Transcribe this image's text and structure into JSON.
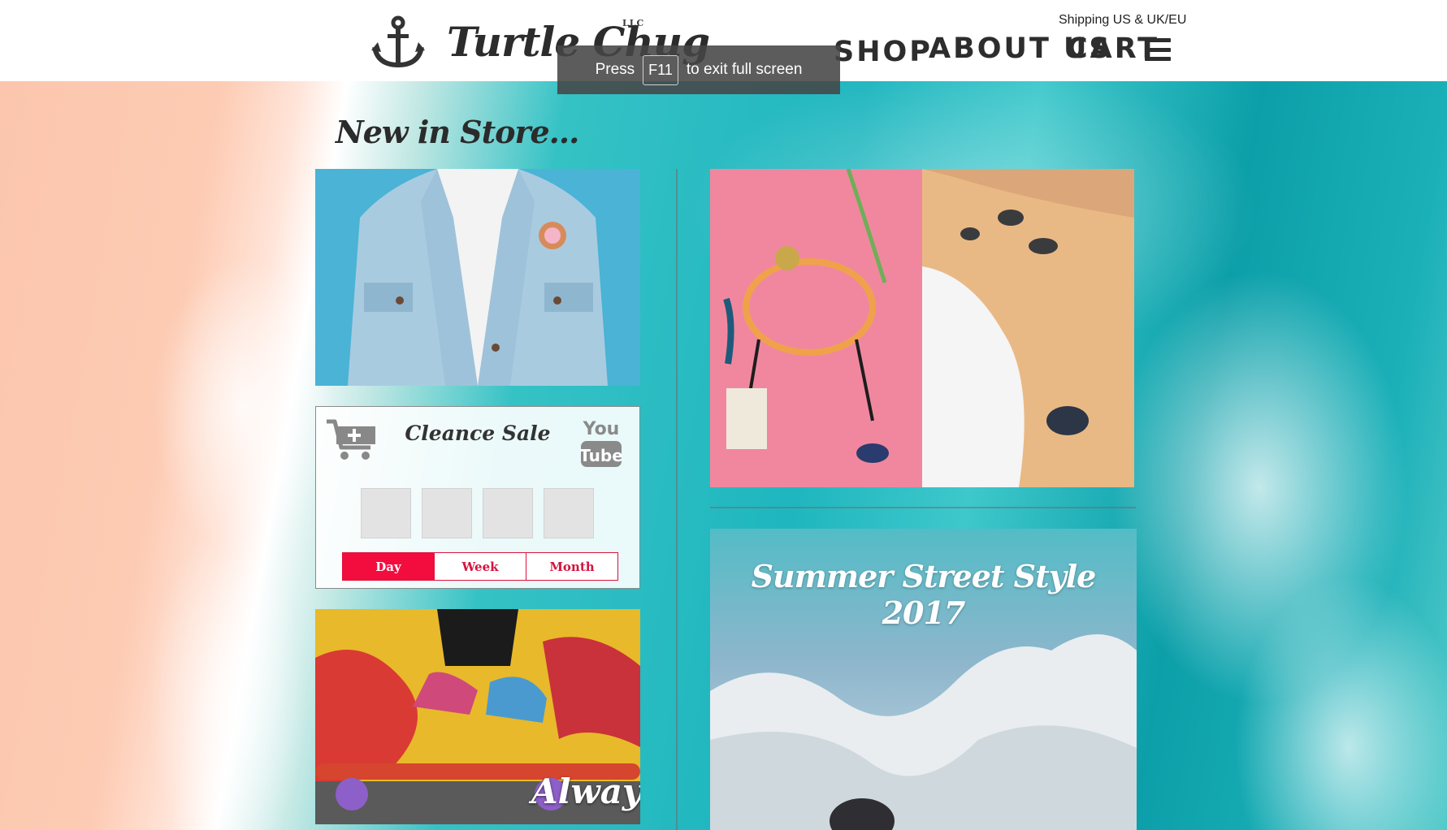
{
  "header": {
    "brand": "Turtle Chug",
    "brand_suffix": "LLC",
    "shipping": "Shipping US & UK/EU",
    "nav": {
      "shop": "SHOP",
      "about": "ABOUT US",
      "cart": "CART"
    },
    "icons": {
      "logo": "anchor-icon",
      "menu": "hamburger-menu-icon"
    }
  },
  "fullscreen_notice": {
    "prefix": "Press",
    "key": "F11",
    "suffix": "to exit full screen"
  },
  "main": {
    "section_title": "New in Store...",
    "sale_card": {
      "title": "Cleance Sale",
      "icons": {
        "cart": "add-to-cart-icon",
        "video": "youtube-icon"
      },
      "countdown": [
        "",
        "",
        "",
        ""
      ],
      "tabs": [
        {
          "label": "Day",
          "active": true
        },
        {
          "label": "Week",
          "active": false
        },
        {
          "label": "Month",
          "active": false
        }
      ]
    },
    "skate_caption": "Always",
    "street_style_title": "Summer Street Style 2017"
  },
  "colors": {
    "accent": "#f30d3f",
    "ocean": "#1fb6bf",
    "sand": "#fbc6ad",
    "text_dark": "#2d2d2d"
  }
}
